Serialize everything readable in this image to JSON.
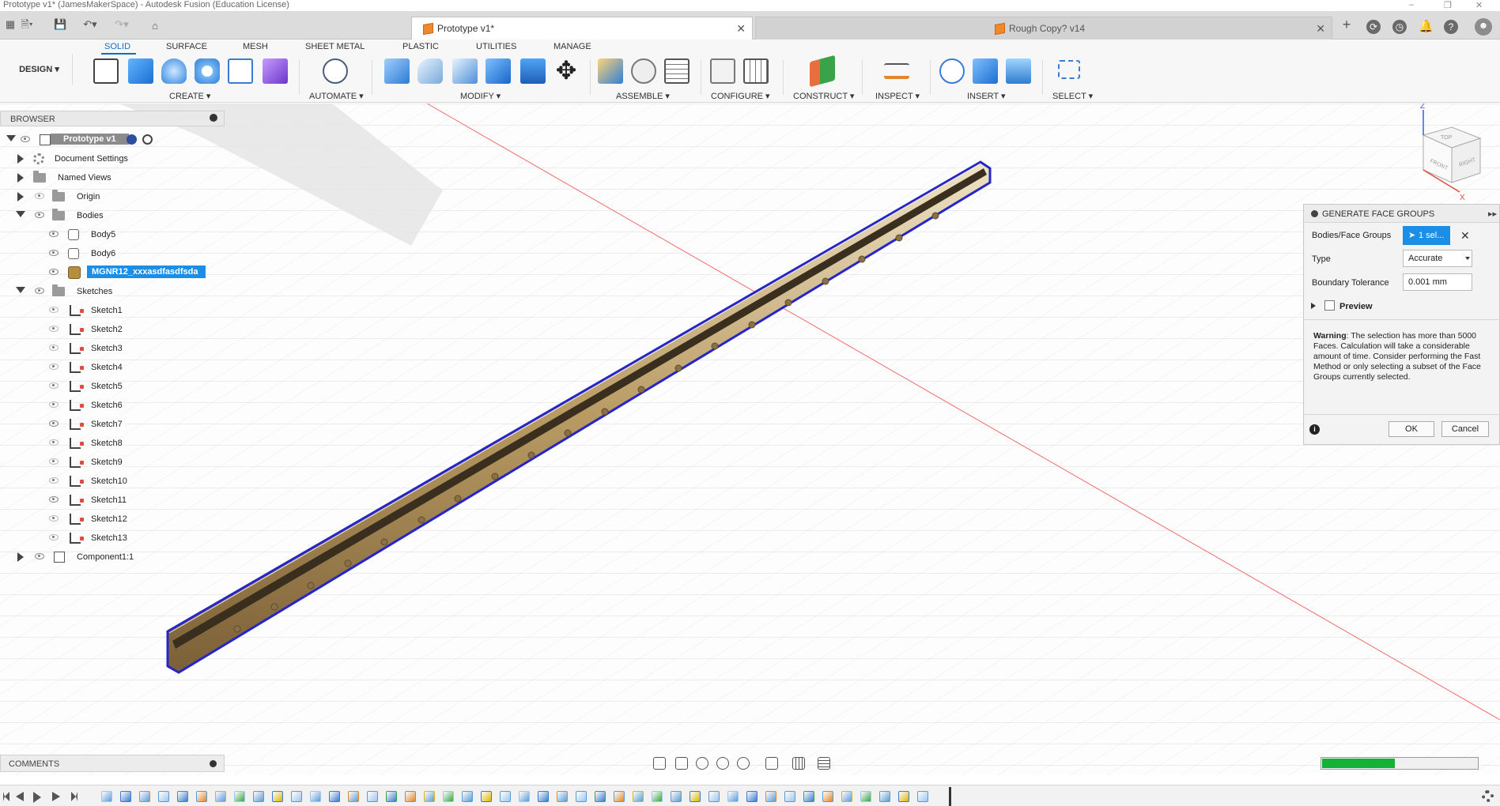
{
  "app": {
    "window_title": "Prototype v1* (JamesMakerSpace) - Autodesk Fusion (Education License)"
  },
  "tabs": [
    {
      "label": "Prototype v1*",
      "active": true
    },
    {
      "label": "Rough Copy? v14",
      "active": false
    }
  ],
  "ribbon": {
    "workspace": "DESIGN",
    "tabs": [
      "SOLID",
      "SURFACE",
      "MESH",
      "SHEET METAL",
      "PLASTIC",
      "UTILITIES",
      "MANAGE"
    ],
    "active_tab": "SOLID",
    "groups": [
      "CREATE",
      "AUTOMATE",
      "MODIFY",
      "ASSEMBLE",
      "CONFIGURE",
      "CONSTRUCT",
      "INSPECT",
      "INSERT",
      "SELECT"
    ]
  },
  "browser": {
    "title": "BROWSER",
    "root": "Prototype v1",
    "items": [
      {
        "label": "Document Settings",
        "kind": "settings"
      },
      {
        "label": "Named Views",
        "kind": "folder"
      },
      {
        "label": "Origin",
        "kind": "folder"
      },
      {
        "label": "Bodies",
        "kind": "folder"
      },
      {
        "label": "Body5",
        "kind": "body"
      },
      {
        "label": "Body6",
        "kind": "body"
      },
      {
        "label": "MGNR12_xxxasdfasdfsda",
        "kind": "body",
        "selected": true
      },
      {
        "label": "Sketches",
        "kind": "folder"
      },
      {
        "label": "Sketch1",
        "kind": "sketch"
      },
      {
        "label": "Sketch2",
        "kind": "sketch"
      },
      {
        "label": "Sketch3",
        "kind": "sketch"
      },
      {
        "label": "Sketch4",
        "kind": "sketch"
      },
      {
        "label": "Sketch5",
        "kind": "sketch"
      },
      {
        "label": "Sketch6",
        "kind": "sketch"
      },
      {
        "label": "Sketch7",
        "kind": "sketch"
      },
      {
        "label": "Sketch8",
        "kind": "sketch"
      },
      {
        "label": "Sketch9",
        "kind": "sketch"
      },
      {
        "label": "Sketch10",
        "kind": "sketch"
      },
      {
        "label": "Sketch11",
        "kind": "sketch"
      },
      {
        "label": "Sketch12",
        "kind": "sketch"
      },
      {
        "label": "Sketch13",
        "kind": "sketch"
      },
      {
        "label": "Component1:1",
        "kind": "component"
      }
    ]
  },
  "dialog": {
    "title": "GENERATE FACE GROUPS",
    "bodies_label": "Bodies/Face Groups",
    "bodies_value": "1 sel...",
    "type_label": "Type",
    "type_value": "Accurate",
    "tolerance_label": "Boundary Tolerance",
    "tolerance_value": "0.001 mm",
    "preview_label": "Preview",
    "warning_bold": "Warning",
    "warning_text": ": The selection has more than 5000 Faces. Calculation will take a considerable amount of time. Consider performing the Fast Method or only selecting a subset of the Face Groups currently selected.",
    "ok": "OK",
    "cancel": "Cancel"
  },
  "comments": {
    "title": "COMMENTS"
  },
  "viewcube": {
    "top": "TOP",
    "front": "FRONT",
    "right": "RIGHT",
    "axis_x": "X",
    "axis_z": "Z"
  },
  "progress": {
    "fraction": 0.47
  },
  "colors": {
    "accent": "#0f6fc6",
    "selection": "#1b8ee8",
    "body_outline": "#2525c8",
    "rail": "#c9ad7a",
    "progress": "#14b037"
  }
}
